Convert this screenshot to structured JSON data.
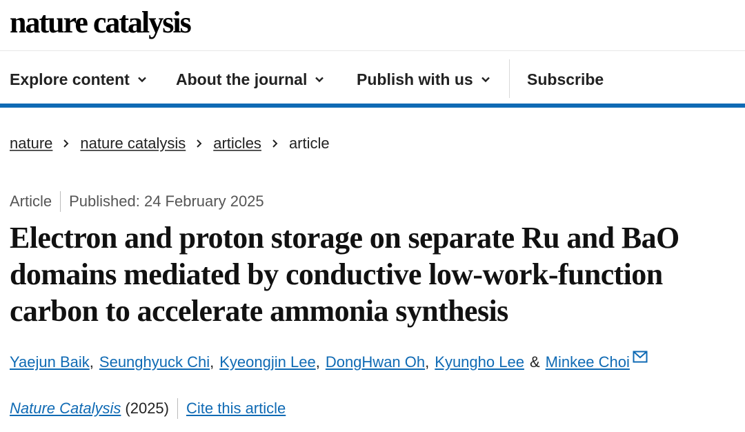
{
  "site": {
    "logo": "nature catalysis"
  },
  "nav": {
    "items": [
      {
        "label": "Explore content",
        "has_dropdown": true
      },
      {
        "label": "About the journal",
        "has_dropdown": true
      },
      {
        "label": "Publish with us",
        "has_dropdown": true
      },
      {
        "label": "Subscribe",
        "has_dropdown": false
      }
    ],
    "accent_color": "#0f6ab4"
  },
  "breadcrumb": {
    "items": [
      "nature",
      "nature catalysis",
      "articles"
    ],
    "current": "article"
  },
  "article": {
    "type": "Article",
    "published": "Published: 24 February 2025",
    "title": "Electron and proton storage on separate Ru and BaO domains mediated by conductive low-work-function carbon to accelerate ammonia synthesis",
    "authors": [
      "Yaejun Baik",
      "Seunghyuck Chi",
      "Kyeongjin Lee",
      "DongHwan Oh",
      "Kyungho Lee",
      "Minkee Choi"
    ],
    "author_separator": ",",
    "last_author_joiner": "&",
    "journal": "Nature Catalysis",
    "year": "(2025)",
    "cite_label": "Cite this article"
  },
  "icons": {
    "nav_dropdown": "chevron-down-icon",
    "breadcrumb_separator": "chevron-right-icon",
    "corresponding_author": "mail-icon"
  }
}
